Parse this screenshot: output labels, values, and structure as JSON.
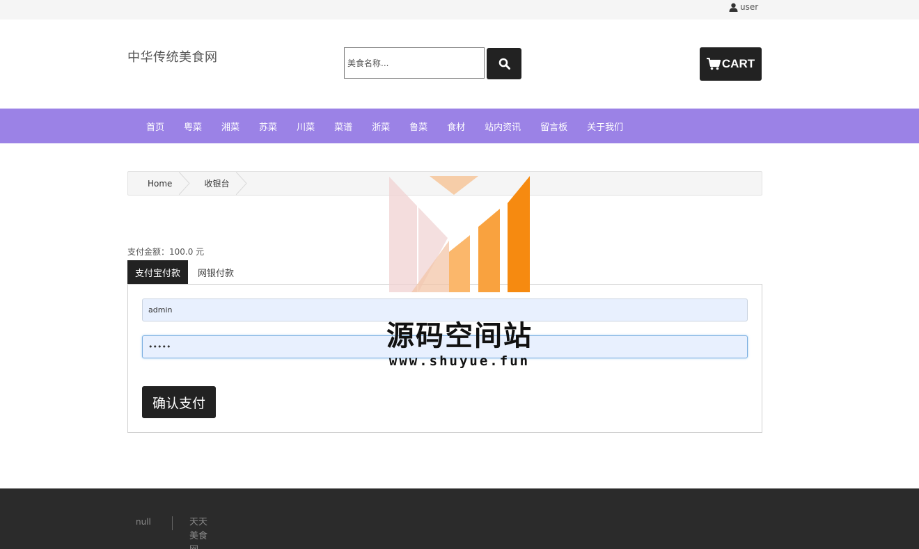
{
  "topbar": {
    "user_label": "user"
  },
  "header": {
    "site_title": "中华传统美食网",
    "search_placeholder": "美食名称...",
    "cart_label": "CART"
  },
  "nav": {
    "items": [
      {
        "label": "首页"
      },
      {
        "label": "粤菜"
      },
      {
        "label": "湘菜"
      },
      {
        "label": "苏菜"
      },
      {
        "label": "川菜"
      },
      {
        "label": "菜谱"
      },
      {
        "label": "浙菜"
      },
      {
        "label": "鲁菜"
      },
      {
        "label": "食材"
      },
      {
        "label": "站内资讯"
      },
      {
        "label": "留言板"
      },
      {
        "label": "关于我们"
      }
    ]
  },
  "breadcrumb": {
    "home": "Home",
    "current": "收银台"
  },
  "payment": {
    "amount_text": "支付金额：100.0 元",
    "tabs": [
      {
        "label": "支付宝付款",
        "active": true
      },
      {
        "label": "网银付款",
        "active": false
      }
    ],
    "username_value": "admin",
    "password_value": "•••••",
    "confirm_label": "确认支付"
  },
  "watermark": {
    "title": "源码空间站",
    "url": "www.shuyue.fun"
  },
  "footer": {
    "left_text": "null",
    "brand_text": "天天美食网"
  },
  "colors": {
    "nav_bg": "#9b82e6",
    "dark": "#222222",
    "footer_bg": "#2b2b2b",
    "input_bg": "#e8f0fe"
  }
}
